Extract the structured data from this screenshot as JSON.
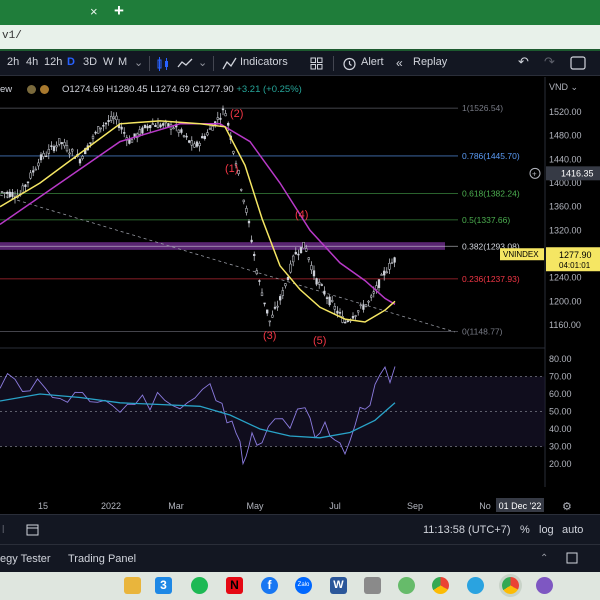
{
  "browser": {
    "tab_close": "×",
    "tab_new": "+",
    "url_fragment": "v1/"
  },
  "toolbar": {
    "intervals": [
      "2h",
      "4h",
      "12h",
      "D",
      "3D",
      "W",
      "M"
    ],
    "active_interval": "D",
    "indicators_label": "Indicators",
    "alert_label": "Alert",
    "replay_label": "Replay",
    "currency": "VND"
  },
  "legend": {
    "prefix": "ew",
    "ohlc": "O1274.69  H1280.45  L1274.69  C1277.90",
    "change": "+3.21 (+0.25%)"
  },
  "price_scale": {
    "ticks": [
      "1520.00",
      "1480.00",
      "1440.00",
      "1400.00",
      "1360.00",
      "1320.00",
      "1280.00",
      "1240.00",
      "1200.00",
      "1160.00"
    ],
    "crosshair_value": "1416.35",
    "last_symbol": "VNINDEX",
    "last_price": "1277.90",
    "last_countdown": "04:01:01"
  },
  "osc_scale": {
    "ticks": [
      "80.00",
      "70.00",
      "60.00",
      "50.00",
      "40.00",
      "30.00",
      "20.00"
    ]
  },
  "time_axis": {
    "labels": [
      "15",
      "2022",
      "Mar",
      "May",
      "Jul",
      "Sep",
      "No"
    ],
    "cursor_label": "01 Dec '22"
  },
  "fib_labels": [
    {
      "text": "1(1526.54)",
      "color": "#787b86"
    },
    {
      "text": "0.786(1445.70)",
      "color": "#5b9cf6"
    },
    {
      "text": "0.618(1382.24)",
      "color": "#4caf50"
    },
    {
      "text": "0.5(1337.66)",
      "color": "#4caf50"
    },
    {
      "text": "0.382(1293.08)",
      "color": "#d1d4dc"
    },
    {
      "text": "0.236(1237.93)",
      "color": "#f23645"
    },
    {
      "text": "0(1148.77)",
      "color": "#787b86"
    }
  ],
  "wave_labels": [
    "(1)",
    "(2)",
    "(3)",
    "(4)",
    "(5)"
  ],
  "bottom_bar": {
    "time": "11:13:58 (UTC+7)",
    "percent": "%",
    "log": "log",
    "auto": "auto"
  },
  "panels": {
    "strategy_tester": "egy Tester",
    "trading_panel": "Trading Panel"
  },
  "colors": {
    "background": "#000000",
    "candles": "#d1d4dc",
    "ema_fast": "#f5e663",
    "ema_slow": "#b839c8",
    "osc_line": "#8c7ce0",
    "osc_signal": "#29a3c8",
    "wave_label": "#f23645",
    "zone": "#6a2c86",
    "tab_green": "#1f7d3a"
  },
  "chart_data": [
    {
      "type": "line",
      "title": "VNINDEX",
      "ylim": [
        1130,
        1545
      ],
      "x": [
        "2021-11",
        "2021-12",
        "2022-01",
        "2022-02",
        "2022-03",
        "2022-04",
        "2022-05",
        "2022-06",
        "2022-07",
        "2022-08"
      ],
      "series": [
        {
          "values": [
            1375,
            1440,
            1490,
            1470,
            1500,
            1460,
            1200,
            1290,
            1160,
            1277.9
          ]
        }
      ],
      "fib_levels": [
        {
          "ratio": 1,
          "value": 1526.54
        },
        {
          "ratio": 0.786,
          "value": 1445.7
        },
        {
          "ratio": 0.618,
          "value": 1382.24
        },
        {
          "ratio": 0.5,
          "value": 1337.66
        },
        {
          "ratio": 0.382,
          "value": 1293.08
        },
        {
          "ratio": 0.236,
          "value": 1237.93
        },
        {
          "ratio": 0,
          "value": 1148.77
        }
      ],
      "annotations": [
        "(1)",
        "(2)",
        "(3)",
        "(4)",
        "(5)"
      ]
    },
    {
      "type": "line",
      "ylim": [
        15,
        85
      ],
      "x": [
        "2021-11",
        "2021-12",
        "2022-01",
        "2022-02",
        "2022-03",
        "2022-04",
        "2022-05",
        "2022-06",
        "2022-07",
        "2022-08"
      ],
      "series": [
        {
          "values": [
            60,
            70,
            65,
            52,
            55,
            66,
            20,
            38,
            28,
            70
          ]
        },
        {
          "values": [
            52,
            56,
            57,
            52,
            47,
            42,
            32,
            29,
            34,
            55
          ]
        }
      ],
      "reference_lines": [
        70,
        50,
        30
      ]
    }
  ]
}
